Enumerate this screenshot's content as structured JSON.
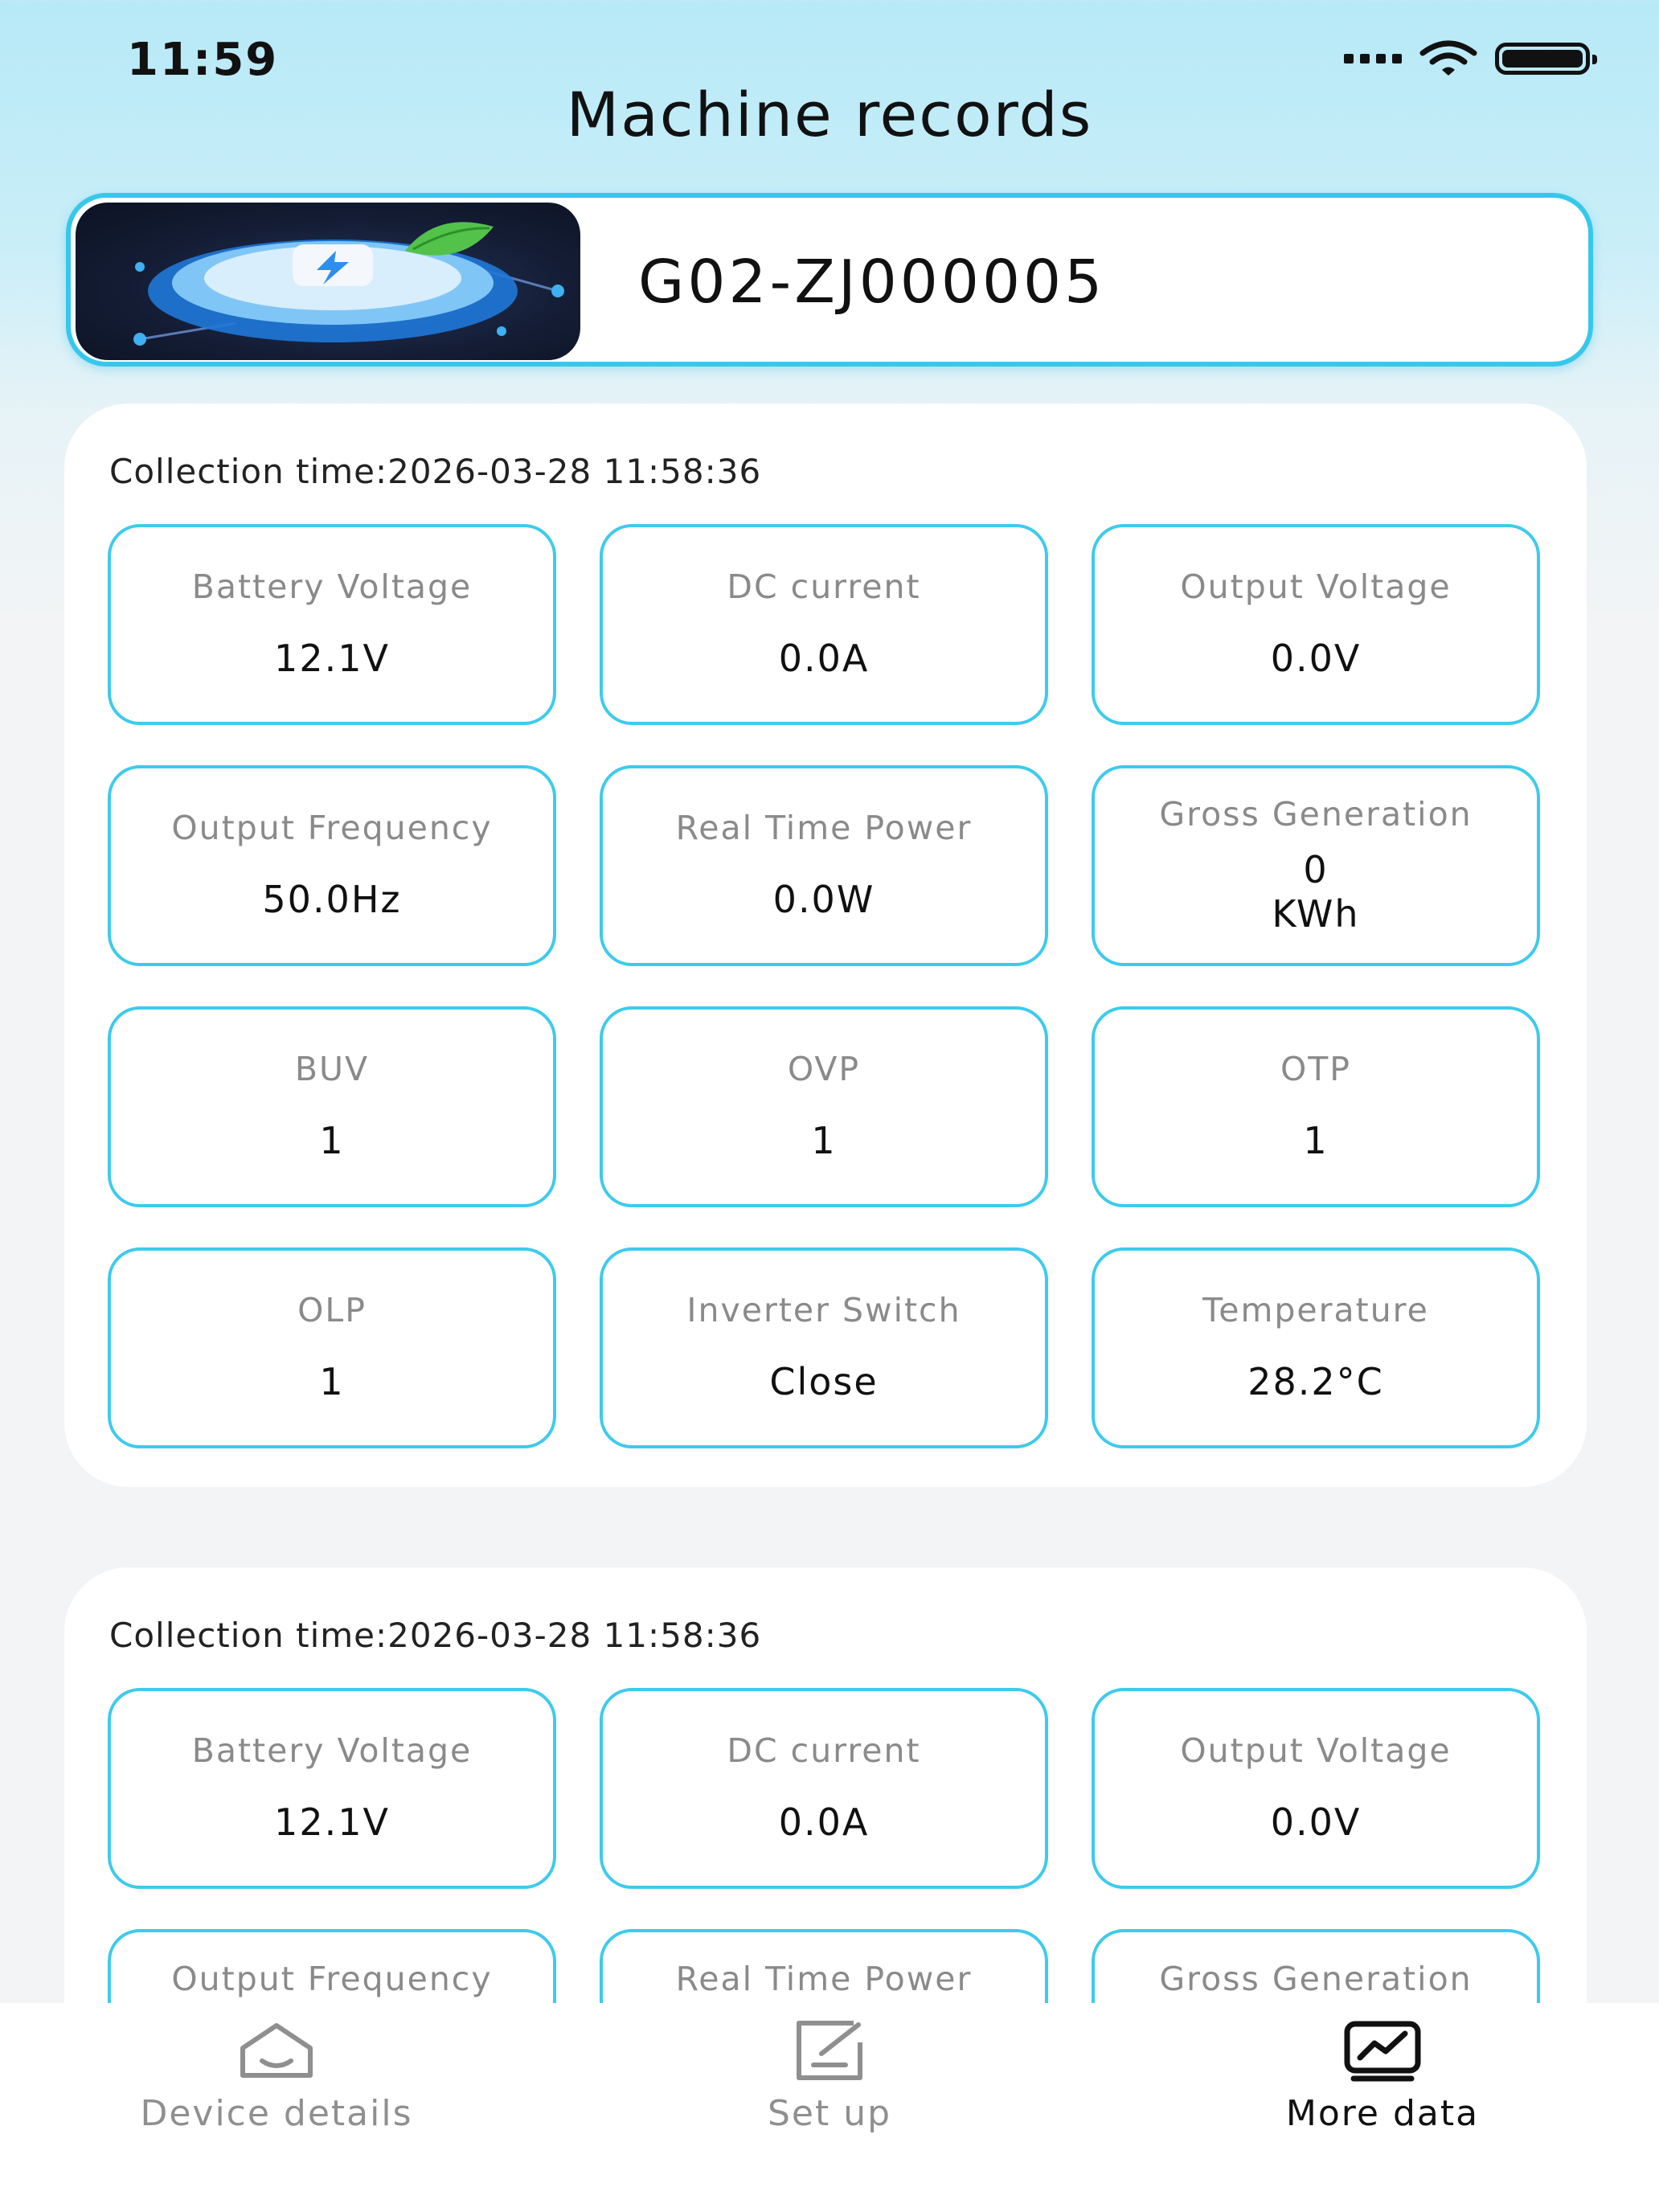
{
  "status_bar": {
    "time": "11:59"
  },
  "header": {
    "title": "Machine records"
  },
  "device": {
    "name": "G02-ZJ000005"
  },
  "records": [
    {
      "collection_time": "Collection time:2026-03-28 11:58:36",
      "metrics": [
        {
          "label": "Battery Voltage",
          "value": "12.1V"
        },
        {
          "label": "DC current",
          "value": "0.0A"
        },
        {
          "label": "Output Voltage",
          "value": "0.0V"
        },
        {
          "label": "Output Frequency",
          "value": "50.0Hz"
        },
        {
          "label": "Real Time Power",
          "value": "0.0W"
        },
        {
          "label": "Gross Generation",
          "value": "0",
          "unit": "KWh"
        },
        {
          "label": "BUV",
          "value": "1"
        },
        {
          "label": "OVP",
          "value": "1"
        },
        {
          "label": "OTP",
          "value": "1"
        },
        {
          "label": "OLP",
          "value": "1"
        },
        {
          "label": "Inverter Switch",
          "value": "Close"
        },
        {
          "label": "Temperature",
          "value": "28.2°C"
        }
      ]
    },
    {
      "collection_time": "Collection time:2026-03-28 11:58:36",
      "metrics": [
        {
          "label": "Battery Voltage",
          "value": "12.1V"
        },
        {
          "label": "DC current",
          "value": "0.0A"
        },
        {
          "label": "Output Voltage",
          "value": "0.0V"
        },
        {
          "label": "Output Frequency"
        },
        {
          "label": "Real Time Power"
        },
        {
          "label": "Gross Generation"
        }
      ]
    }
  ],
  "tabs": [
    {
      "label": "Device details",
      "icon": "home-icon",
      "active": false
    },
    {
      "label": "Set up",
      "icon": "edit-icon",
      "active": false
    },
    {
      "label": "More data",
      "icon": "chart-icon",
      "active": true
    }
  ],
  "colors": {
    "accent": "#3dcbec",
    "header_bg": "#b7e9f7"
  }
}
